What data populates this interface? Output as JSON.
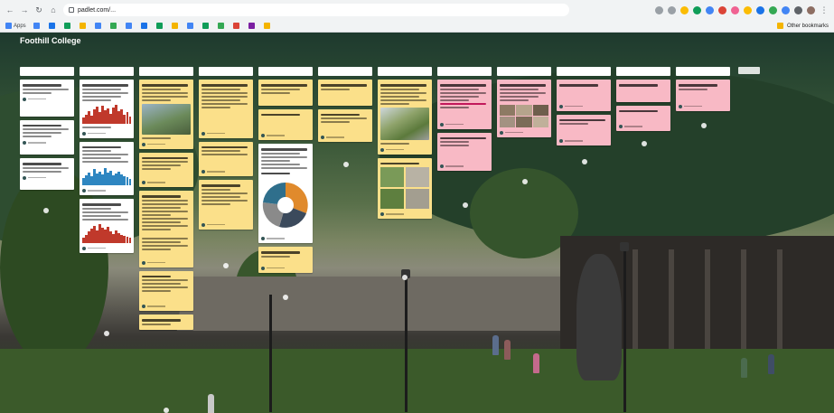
{
  "browser": {
    "url": "padlet.com/...",
    "bookmarks": [
      {
        "label": "Apps",
        "color": "#4285f4"
      },
      {
        "label": "",
        "color": "#4285f4"
      },
      {
        "label": "",
        "color": "#1a73e8"
      },
      {
        "label": "",
        "color": "#0f9d58"
      },
      {
        "label": "",
        "color": "#f4b400"
      },
      {
        "label": "",
        "color": "#4285f4"
      },
      {
        "label": "",
        "color": "#34a853"
      },
      {
        "label": "",
        "color": "#4285f4"
      },
      {
        "label": "",
        "color": "#1a73e8"
      },
      {
        "label": "",
        "color": "#0f9d58"
      },
      {
        "label": "",
        "color": "#f4b400"
      },
      {
        "label": "",
        "color": "#4285f4"
      },
      {
        "label": "",
        "color": "#0f9d58"
      },
      {
        "label": "",
        "color": "#34a853"
      },
      {
        "label": "",
        "color": "#db4437"
      },
      {
        "label": "",
        "color": "#7b1fa2"
      },
      {
        "label": "",
        "color": "#f4b400"
      }
    ],
    "other_bookmarks": "Other bookmarks"
  },
  "board": {
    "title": "Foothill College",
    "logo_text": "",
    "subtitle": "",
    "menu": ""
  },
  "columns": [
    {
      "title": ""
    },
    {
      "title": ""
    },
    {
      "title": ""
    },
    {
      "title": ""
    },
    {
      "title": ""
    },
    {
      "title": ""
    },
    {
      "title": ""
    },
    {
      "title": ""
    },
    {
      "title": ""
    },
    {
      "title": ""
    },
    {
      "title": ""
    },
    {
      "title": ""
    }
  ],
  "add_column_label": ""
}
